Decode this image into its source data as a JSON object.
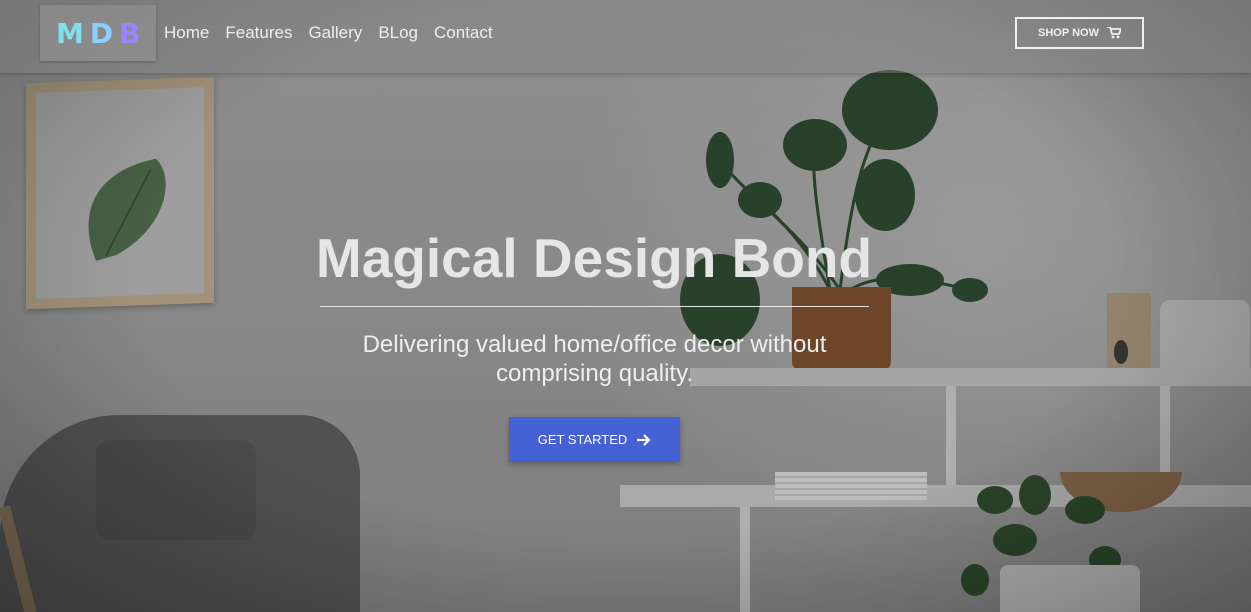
{
  "brand": {
    "logo_letters": [
      "M",
      "D",
      "B"
    ],
    "logo_colors": [
      "#7fe0ec",
      "#8ad0ff",
      "#9a86ff"
    ]
  },
  "nav": {
    "links": [
      "Home",
      "Features",
      "Gallery",
      "BLog",
      "Contact"
    ],
    "shop_button_label": "SHOP NOW",
    "shop_button_icon": "cart-icon"
  },
  "hero": {
    "title": "Magical Design Bond",
    "subtitle": "Delivering valued home/office decor without comprising quality.",
    "cta_label": "GET STARTED",
    "cta_icon": "arrow-right-icon"
  },
  "colors": {
    "accent": "#4661d4",
    "text": "#e6e6e6"
  }
}
